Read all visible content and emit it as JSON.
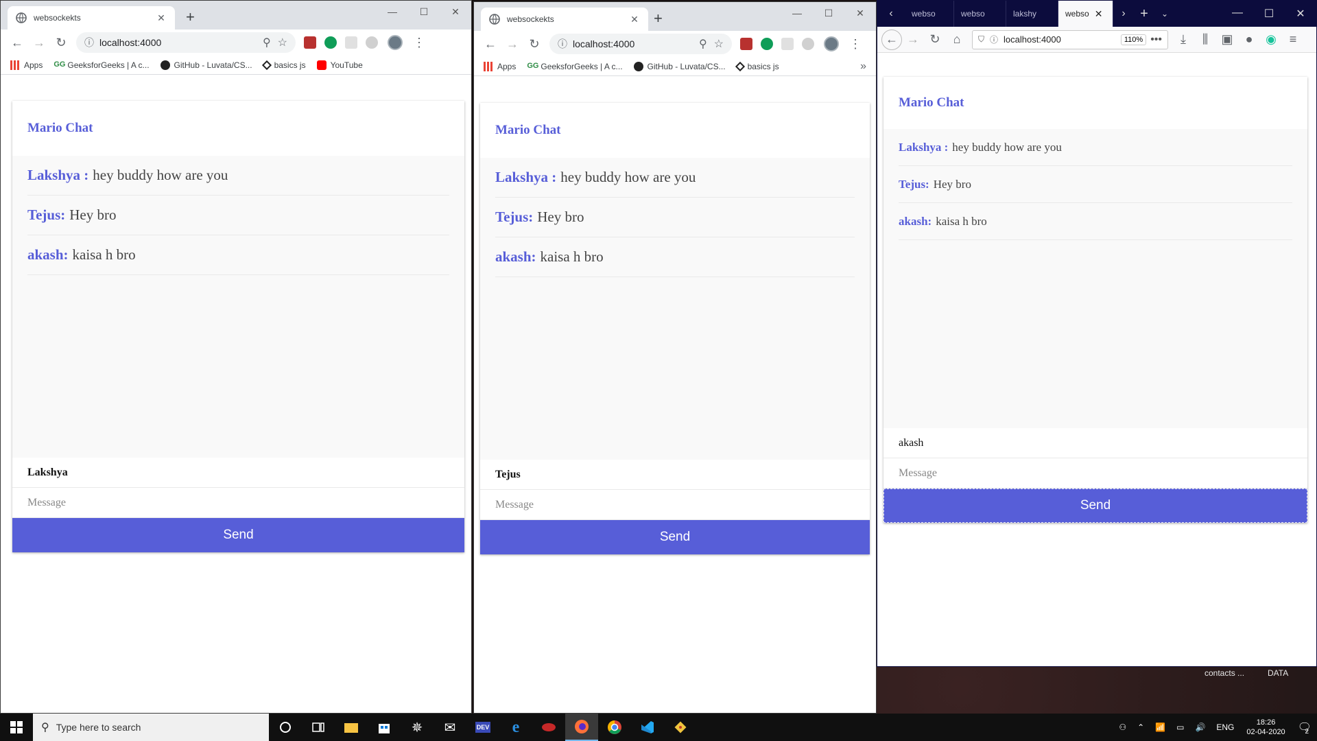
{
  "desktop": {
    "labels": [
      "contacts ...",
      "DATA"
    ]
  },
  "window1": {
    "tab_title": "websockekts",
    "url": "localhost:4000",
    "bookmarks": [
      "Apps",
      "GeeksforGeeks | A c...",
      "GitHub - Luvata/CS...",
      "basics js",
      "YouTube"
    ],
    "chat": {
      "title": "Mario Chat",
      "messages": [
        {
          "handle": "Lakshya :",
          "text": "hey buddy how are you"
        },
        {
          "handle": "Tejus:",
          "text": "Hey bro"
        },
        {
          "handle": "akash:",
          "text": "kaisa h bro"
        }
      ],
      "handle_value": "Lakshya",
      "message_placeholder": "Message",
      "send_label": "Send"
    }
  },
  "window2": {
    "tab_title": "websockekts",
    "url": "localhost:4000",
    "bookmarks": [
      "Apps",
      "GeeksforGeeks | A c...",
      "GitHub - Luvata/CS...",
      "basics js"
    ],
    "overflow": "»",
    "chat": {
      "title": "Mario Chat",
      "messages": [
        {
          "handle": "Lakshya :",
          "text": "hey buddy how are you"
        },
        {
          "handle": "Tejus:",
          "text": "Hey bro"
        },
        {
          "handle": "akash:",
          "text": "kaisa h bro"
        }
      ],
      "handle_value": "Tejus",
      "message_placeholder": "Message",
      "send_label": "Send"
    }
  },
  "window3": {
    "tabs": [
      "webso",
      "webso",
      "lakshy",
      "webso"
    ],
    "url": "localhost:4000",
    "zoom": "110%",
    "chat": {
      "title": "Mario Chat",
      "messages": [
        {
          "handle": "Lakshya :",
          "text": "hey buddy how are you"
        },
        {
          "handle": "Tejus:",
          "text": "Hey bro"
        },
        {
          "handle": "akash:",
          "text": "kaisa h bro"
        }
      ],
      "handle_value": "akash",
      "message_placeholder": "Message",
      "send_label": "Send"
    }
  },
  "taskbar": {
    "search_placeholder": "Type here to search",
    "language": "ENG",
    "time": "18:26",
    "date": "02-04-2020",
    "notifications": "2"
  },
  "colors": {
    "accent": "#575ed8",
    "firefox_tabbar": "#0c0c3d"
  }
}
